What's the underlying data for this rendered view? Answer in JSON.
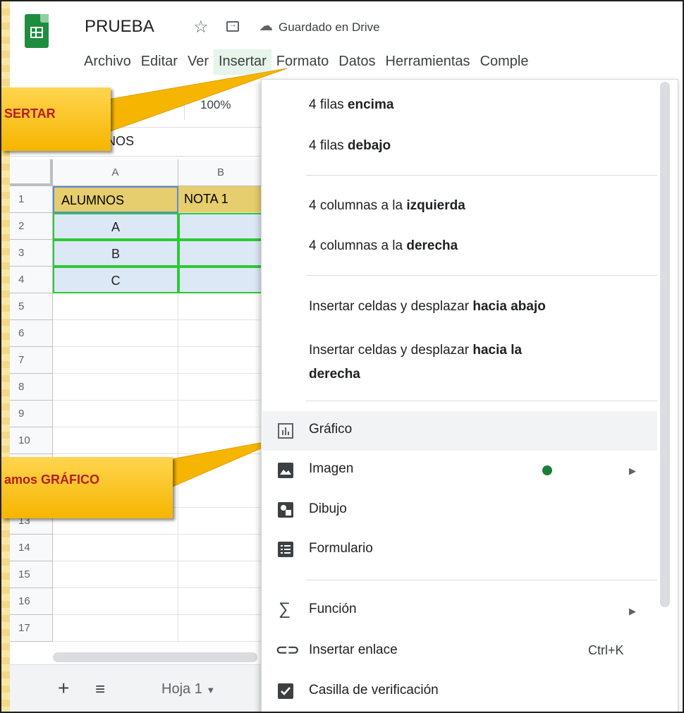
{
  "app": {
    "title": "PRUEBA",
    "save_status": "Guardado en Drive"
  },
  "menubar": {
    "items": [
      "Archivo",
      "Editar",
      "Ver",
      "Insertar",
      "Formato",
      "Datos",
      "Herramientas",
      "Comple"
    ]
  },
  "toolbar": {
    "zoom": "100%"
  },
  "formula_bar": {
    "name_value": "NOS"
  },
  "sheet": {
    "columns": [
      "A",
      "B"
    ],
    "rows": [
      "1",
      "2",
      "3",
      "4",
      "5",
      "6",
      "7",
      "8",
      "9",
      "10",
      "13",
      "14",
      "15",
      "16",
      "17"
    ],
    "cells": {
      "a1": "ALUMNOS",
      "b1": "NOTA 1",
      "a2": "A",
      "a3": "B",
      "a4": "C"
    }
  },
  "tabs": {
    "sheet_name": "Hoja 1"
  },
  "callouts": {
    "first": "SERTAR",
    "second": "amos GRÁFICO"
  },
  "insert_menu": {
    "rows_above_pre": "4 filas ",
    "rows_above_bold": "encima",
    "rows_below_pre": "4 filas ",
    "rows_below_bold": "debajo",
    "cols_left_pre": "4 columnas a la ",
    "cols_left_bold": "izquierda",
    "cols_right_pre": "4 columnas a la ",
    "cols_right_bold": "derecha",
    "shift_down_pre": "Insertar celdas y desplazar ",
    "shift_down_bold": "hacia abajo",
    "shift_right_pre": "Insertar celdas y desplazar ",
    "shift_right_bold1": "hacia la",
    "shift_right_bold2": "derecha",
    "chart": "Gráfico",
    "image": "Imagen",
    "drawing": "Dibujo",
    "form": "Formulario",
    "function": "Función",
    "link": "Insertar enlace",
    "link_shortcut": "Ctrl+K",
    "checkbox": "Casilla de verificación"
  },
  "colors": {
    "brand_green": "#1e8e3e",
    "callout_fill": "#f6b500",
    "callout_text": "#b71c1c",
    "header_cell": "#e6cd6d",
    "data_cell": "#dde8f7",
    "selection_border": "#2ec934"
  },
  "icons": [
    "sheets-logo-icon",
    "star-icon",
    "move-to-folder-icon",
    "cloud-saved-icon",
    "chart-icon",
    "image-icon",
    "drawing-icon",
    "form-icon",
    "sigma-icon",
    "link-icon",
    "checkbox-icon",
    "submenu-arrow-icon",
    "plus-icon",
    "sheets-list-icon",
    "tab-dropdown-icon"
  ]
}
